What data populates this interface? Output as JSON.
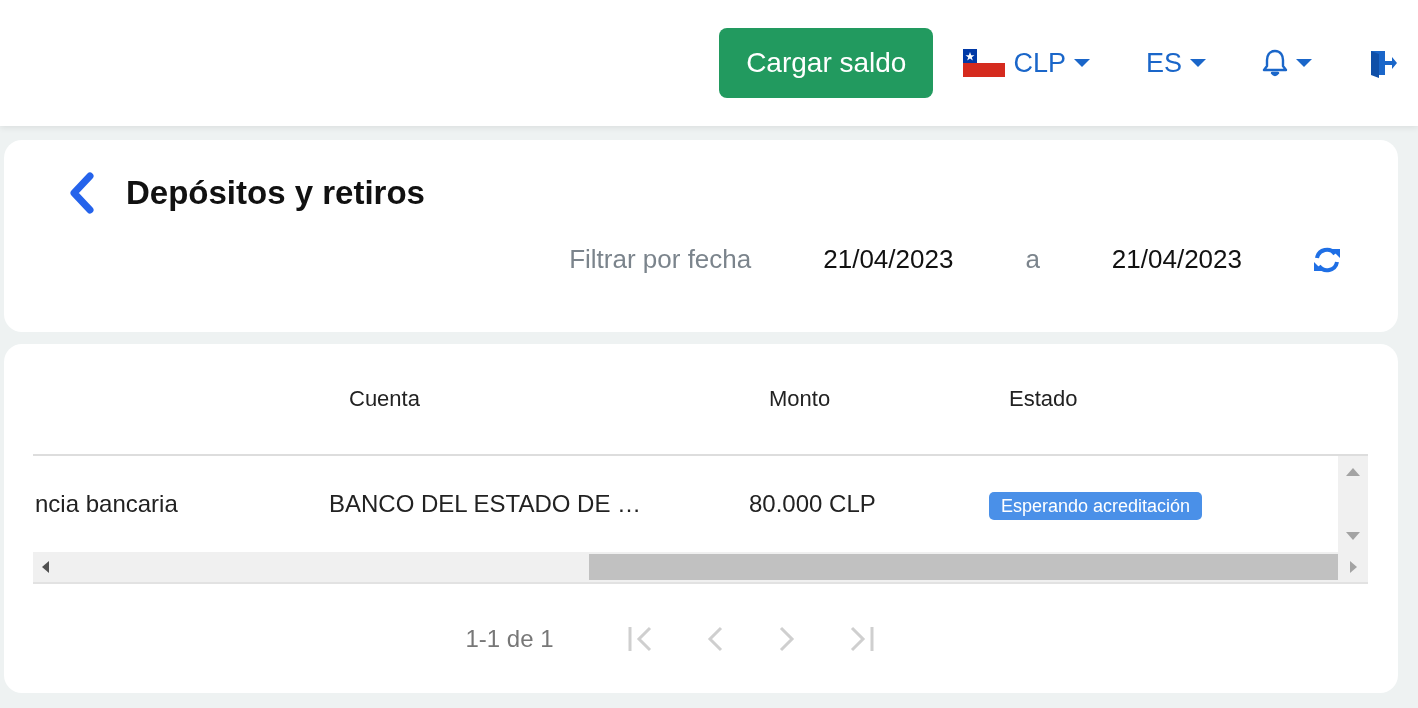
{
  "header": {
    "top_up_button": "Cargar saldo",
    "currency": "CLP",
    "language": "ES"
  },
  "page": {
    "title": "Depósitos y retiros",
    "filter_label": "Filtrar por fecha",
    "date_from": "21/04/2023",
    "separator": "a",
    "date_to": "21/04/2023"
  },
  "table": {
    "columns": [
      "",
      "Cuenta",
      "Monto",
      "Estado"
    ],
    "rows": [
      {
        "cells": [
          "ncia bancaria",
          "BANCO DEL ESTADO DE …",
          "80.000 CLP"
        ],
        "status": "Esperando acreditación"
      }
    ]
  },
  "pagination": {
    "range": "1-1 de 1",
    "first_disabled": true,
    "prev_disabled": true,
    "next_disabled": true,
    "last_disabled": true
  }
}
